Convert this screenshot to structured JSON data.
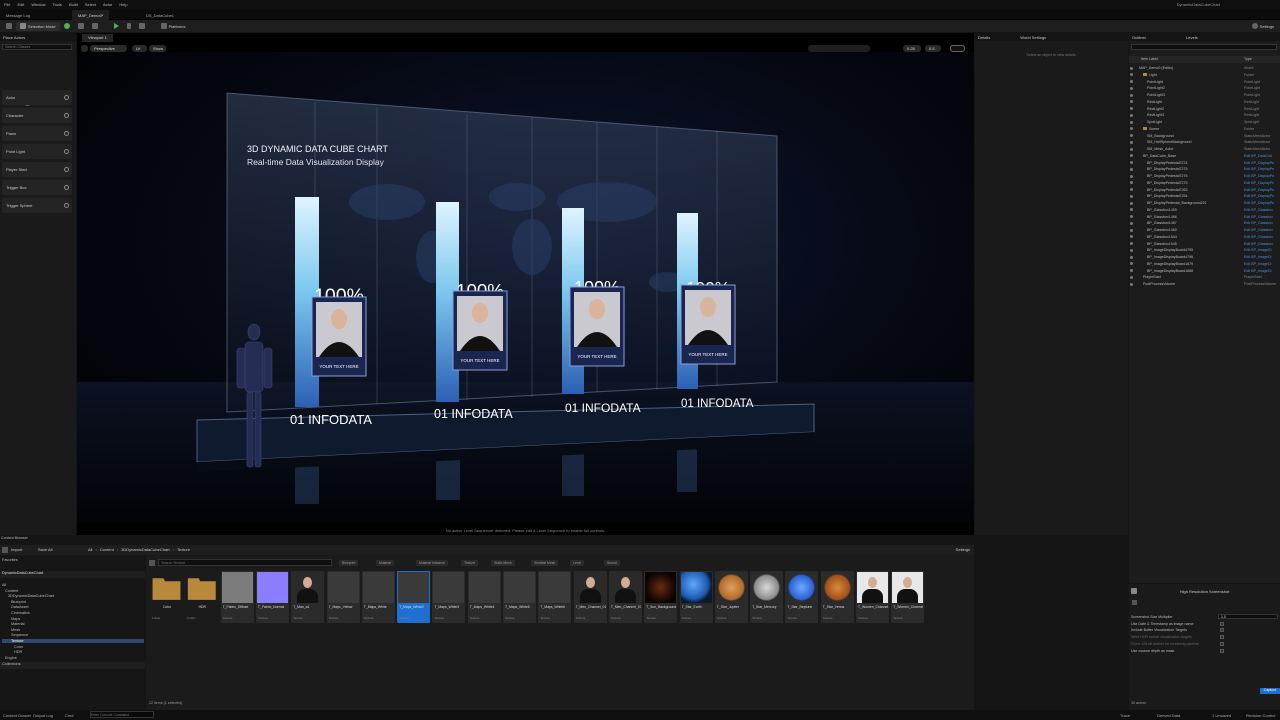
{
  "menu": [
    "File",
    "Edit",
    "Window",
    "Tools",
    "Build",
    "Select",
    "Actor",
    "Help"
  ],
  "project_name": "DynamicDataCubeChart",
  "tabs": [
    {
      "label": "Message Log",
      "active": false
    },
    {
      "label": "MAP_Demo0*",
      "active": true
    },
    {
      "label": "DS_DataCube1",
      "active": false
    }
  ],
  "toolbar": {
    "mode": "Selection Mode",
    "platforms": "Platforms",
    "settings": "Settings"
  },
  "place_actors": {
    "title": "Place Actors",
    "search_placeholder": "Search Classes",
    "basic_label": "BASIC",
    "items": [
      "Actor",
      "Character",
      "Pawn",
      "Point Light",
      "Player Start",
      "Trigger Box",
      "Trigger Sphere"
    ]
  },
  "viewport": {
    "tab": "Viewport 1",
    "perspective": "Perspective",
    "lit": "Lit",
    "show": "Show",
    "speed": "0.25",
    "camera_speed": "0.5",
    "footer": "No active Level Sequencer detected. Please edit a Level Sequence to enable full controls.",
    "scene": {
      "title_line1": "3D DYNAMIC DATA CUBE CHART",
      "title_line2": "Real-time Data Visualization Display",
      "columns": [
        {
          "percent": "100%",
          "caption": "01 INFODATA",
          "card_text": "YOUR TEXT HERE"
        },
        {
          "percent": "100%",
          "caption": "01 INFODATA",
          "card_text": "YOUR TEXT HERE"
        },
        {
          "percent": "100%",
          "caption": "01 INFODATA",
          "card_text": "YOUR TEXT HERE"
        },
        {
          "percent": "100%",
          "caption": "01 INFODATA",
          "card_text": "YOUR TEXT HERE"
        }
      ]
    }
  },
  "details": {
    "tab": "Details",
    "tab2": "World Settings",
    "empty": "Select an object to view details."
  },
  "outliner": {
    "tab": "Outliner",
    "tab2": "Levels",
    "col1": "Item Label",
    "col2": "Type",
    "rows": [
      {
        "indent": 1,
        "label": "MAP_Demo0 (Editor)",
        "type": "World",
        "folder": false
      },
      {
        "indent": 2,
        "label": "Light",
        "type": "Folder",
        "folder": true
      },
      {
        "indent": 3,
        "label": "PointLight",
        "type": "PointLight"
      },
      {
        "indent": 3,
        "label": "PointLight2",
        "type": "PointLight"
      },
      {
        "indent": 3,
        "label": "PointLight3",
        "type": "PointLight"
      },
      {
        "indent": 3,
        "label": "RectLight",
        "type": "RectLight"
      },
      {
        "indent": 3,
        "label": "RectLight2",
        "type": "RectLight"
      },
      {
        "indent": 3,
        "label": "RectLight3",
        "type": "RectLight"
      },
      {
        "indent": 3,
        "label": "SpotLight",
        "type": "SpotLight"
      },
      {
        "indent": 2,
        "label": "Scene",
        "type": "Folder",
        "folder": true
      },
      {
        "indent": 3,
        "label": "SM_Background",
        "type": "StaticMeshActor"
      },
      {
        "indent": 3,
        "label": "SM_HalfSphereBackground",
        "type": "StaticMeshActor"
      },
      {
        "indent": 3,
        "label": "SM_Mesh_Actor",
        "type": "StaticMeshActor"
      },
      {
        "indent": 2,
        "label": "BP_DataCube_Base",
        "type": "Edit BP_DataCub",
        "link": true
      },
      {
        "indent": 3,
        "label": "BP_DisplayPedestal7274",
        "type": "Edit BP_DisplayPe",
        "link": true
      },
      {
        "indent": 3,
        "label": "BP_DisplayPedestal7275",
        "type": "Edit BP_DisplayPe",
        "link": true
      },
      {
        "indent": 3,
        "label": "BP_DisplayPedestal7276",
        "type": "Edit BP_DisplayPe",
        "link": true
      },
      {
        "indent": 3,
        "label": "BP_DisplayPedestal7279",
        "type": "Edit BP_DisplayPe",
        "link": true
      },
      {
        "indent": 3,
        "label": "BP_DisplayPedestal7263",
        "type": "Edit BP_DisplayPe",
        "link": true
      },
      {
        "indent": 3,
        "label": "BP_DisplayPedestal7254",
        "type": "Edit BP_DisplayPe",
        "link": true
      },
      {
        "indent": 3,
        "label": "BP_DisplayPedestal_Background221",
        "type": "Edit BP_DisplayPe",
        "link": true
      },
      {
        "indent": 3,
        "label": "BP_Glassbox1459",
        "type": "Edit BP_Glassbox",
        "link": true
      },
      {
        "indent": 3,
        "label": "BP_Glassbox1466",
        "type": "Edit BP_Glassbox",
        "link": true
      },
      {
        "indent": 3,
        "label": "BP_Glassbox1467",
        "type": "Edit BP_Glassbox",
        "link": true
      },
      {
        "indent": 3,
        "label": "BP_Glassbox1460",
        "type": "Edit BP_Glassbox",
        "link": true
      },
      {
        "indent": 3,
        "label": "BP_Glassbox1544",
        "type": "Edit BP_Glassbox",
        "link": true
      },
      {
        "indent": 3,
        "label": "BP_Glassbox1545",
        "type": "Edit BP_Glassbox",
        "link": true
      },
      {
        "indent": 3,
        "label": "BP_ImageDisplayBoard4795",
        "type": "Edit BP_ImageDi",
        "link": true
      },
      {
        "indent": 3,
        "label": "BP_ImageDisplayBoard4796",
        "type": "Edit BP_ImageDi",
        "link": true
      },
      {
        "indent": 3,
        "label": "BP_ImageDisplayBoard1879",
        "type": "Edit BP_ImageDi",
        "link": true
      },
      {
        "indent": 3,
        "label": "BP_ImageDisplayBoard1888",
        "type": "Edit BP_ImageDi",
        "link": true
      },
      {
        "indent": 2,
        "label": "PlayerStart",
        "type": "PlayerStart"
      },
      {
        "indent": 2,
        "label": "PostProcessVolume",
        "type": "PostProcessVolume"
      }
    ]
  },
  "hires": {
    "title": "High Resolution Screenshot",
    "rows": [
      {
        "label": "Screenshot Size Multiplier",
        "value": "1.0",
        "dim": false
      },
      {
        "label": "Use Date & Timestamp as image name",
        "dim": false
      },
      {
        "label": "Include Buffer Visualization Targets",
        "dim": false
      },
      {
        "label": "Write HDR format visualization targets",
        "dim": true
      },
      {
        "label": "Force 128-bit buffers for rendering pipeline",
        "dim": true
      },
      {
        "label": "Use custom depth as mask",
        "dim": false
      }
    ],
    "capture": "Capture",
    "footer": "30 actors"
  },
  "content_browser": {
    "title": "Content Browser",
    "import": "Import",
    "save_all": "Save All",
    "breadcrumb": [
      "All",
      "Content",
      "3DDynamicDataCubeChart",
      "Texture"
    ],
    "settings": "Settings",
    "search_placeholder": "Search Texture",
    "filters": [
      "Blueprint",
      "Material",
      "Material Instance",
      "Texture",
      "Static Mesh",
      "Skeletal Mesh",
      "Level",
      "Sound"
    ],
    "favorites_label": "Favorites",
    "project_label": "DynamicDataCubeChart",
    "tree": [
      {
        "label": "All",
        "indent": 0
      },
      {
        "label": "Content",
        "indent": 1
      },
      {
        "label": "3DDynamicDataCubeChart",
        "indent": 2
      },
      {
        "label": "Blueprint",
        "indent": 3
      },
      {
        "label": "DataAsset",
        "indent": 3
      },
      {
        "label": "Cinematics",
        "indent": 3
      },
      {
        "label": "Maps",
        "indent": 3
      },
      {
        "label": "Material",
        "indent": 3
      },
      {
        "label": "Mesh",
        "indent": 3
      },
      {
        "label": "Sequence",
        "indent": 3
      },
      {
        "label": "Texture",
        "indent": 3,
        "selected": true
      },
      {
        "label": "Color",
        "indent": 4
      },
      {
        "label": "HDR",
        "indent": 4
      },
      {
        "label": "Engine",
        "indent": 1
      }
    ],
    "collections_label": "Collections",
    "assets": [
      {
        "name": "Color",
        "type": "Folder",
        "kind": "folder"
      },
      {
        "name": "HDR",
        "type": "Folder",
        "kind": "folder"
      },
      {
        "name": "T_Fabric_Diffuse",
        "type": "Texture",
        "kind": "gray"
      },
      {
        "name": "T_Fabric_Normal",
        "type": "Texture",
        "kind": "normal"
      },
      {
        "name": "T_Man_a1",
        "type": "Texture",
        "kind": "man"
      },
      {
        "name": "T_Maps_Yellow",
        "type": "Texture",
        "kind": "map"
      },
      {
        "name": "T_Maps_White",
        "type": "Texture",
        "kind": "map"
      },
      {
        "name": "T_Maps_White2",
        "type": "Texture",
        "kind": "map",
        "selected": true
      },
      {
        "name": "T_Maps_White3",
        "type": "Texture",
        "kind": "map"
      },
      {
        "name": "T_Maps_White4",
        "type": "Texture",
        "kind": "map"
      },
      {
        "name": "T_Maps_White5",
        "type": "Texture",
        "kind": "map"
      },
      {
        "name": "T_Maps_White6",
        "type": "Texture",
        "kind": "map"
      },
      {
        "name": "T_Men_Channel_01",
        "type": "Texture",
        "kind": "man"
      },
      {
        "name": "T_Men_Channel_03",
        "type": "Texture",
        "kind": "man"
      },
      {
        "name": "T_Sun_Background",
        "type": "Texture",
        "kind": "sun"
      },
      {
        "name": "T_Star_Earth",
        "type": "Texture",
        "kind": "earth"
      },
      {
        "name": "T_Star_Jupiter",
        "type": "Texture",
        "kind": "jupiter"
      },
      {
        "name": "T_Star_Mercury",
        "type": "Texture",
        "kind": "mercury"
      },
      {
        "name": "T_Star_Neptune",
        "type": "Texture",
        "kind": "neptune"
      },
      {
        "name": "T_Star_Venus",
        "type": "Texture",
        "kind": "venus"
      },
      {
        "name": "T_Women_Channel_11",
        "type": "Texture",
        "kind": "woman"
      },
      {
        "name": "T_Women_Channel_02",
        "type": "Texture",
        "kind": "woman"
      }
    ],
    "count": "22 items (1 selected)"
  },
  "status": {
    "drawer": "Content Drawer",
    "output": "Output Log",
    "cmd": "Cmd",
    "cmd_placeholder": "Enter Console Command",
    "trace": "Trace",
    "derived": "Derived Data",
    "unsaved": "1 Unsaved",
    "revision": "Revision Control"
  }
}
